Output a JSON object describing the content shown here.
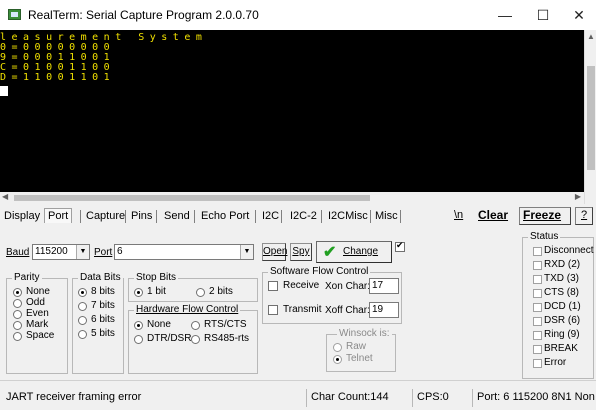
{
  "window": {
    "title": "RealTerm: Serial Capture Program 2.0.0.70",
    "minimize": "—",
    "maximize": "☐",
    "close": "✕"
  },
  "terminal": {
    "lines": [
      "leasurement System",
      "0=00000000",
      "9=00011001",
      "C=01001100",
      "D=11001101"
    ],
    "text_color": "#f0e000",
    "background": "#000000"
  },
  "tabs": {
    "items": [
      "Display",
      "Port",
      "Capture",
      "Pins",
      "Send",
      "Echo Port",
      "I2C",
      "I2C-2",
      "I2CMisc",
      "Misc"
    ],
    "active": "Port",
    "right_buttons": {
      "newline": "\\n",
      "clear": "Clear",
      "freeze": "Freeze",
      "help": "?"
    }
  },
  "port": {
    "baud_label": "Baud",
    "baud_value": "115200",
    "port_label": "Port",
    "port_value": "6",
    "open_label": "Open",
    "spy_label": "Spy",
    "change_label": "Change",
    "change_checked": true,
    "parity": {
      "title": "Parity",
      "options": [
        "None",
        "Odd",
        "Even",
        "Mark",
        "Space"
      ],
      "selected": "None"
    },
    "data_bits": {
      "title": "Data Bits",
      "options": [
        "8 bits",
        "7 bits",
        "6 bits",
        "5 bits"
      ],
      "selected": "8 bits"
    },
    "stop_bits": {
      "title": "Stop Bits",
      "options": [
        "1 bit",
        "2 bits"
      ],
      "selected": "1 bit"
    },
    "hardware_flow": {
      "title": "Hardware Flow Control",
      "options": [
        "None",
        "RTS/CTS",
        "DTR/DSR",
        "RS485-rts"
      ],
      "selected": "None"
    },
    "software_flow": {
      "title": "Software Flow Control",
      "receive_label": "Receive",
      "xon_label": "Xon Char:",
      "xon_value": "17",
      "transmit_label": "Transmit",
      "xoff_label": "Xoff Char:",
      "xoff_value": "19"
    },
    "winsock": {
      "title": "Winsock is:",
      "options": [
        "Raw",
        "Telnet"
      ],
      "selected": "Telnet"
    },
    "status": {
      "title": "Status",
      "items": [
        "Disconnect",
        "RXD (2)",
        "TXD (3)",
        "CTS (8)",
        "DCD (1)",
        "DSR (6)",
        "Ring (9)",
        "BREAK",
        "Error"
      ]
    }
  },
  "statusbar": {
    "message": "JART receiver framing error",
    "char_count": "Char Count:144",
    "cps": "CPS:0",
    "port_info": "Port: 6 115200 8N1 Non"
  }
}
